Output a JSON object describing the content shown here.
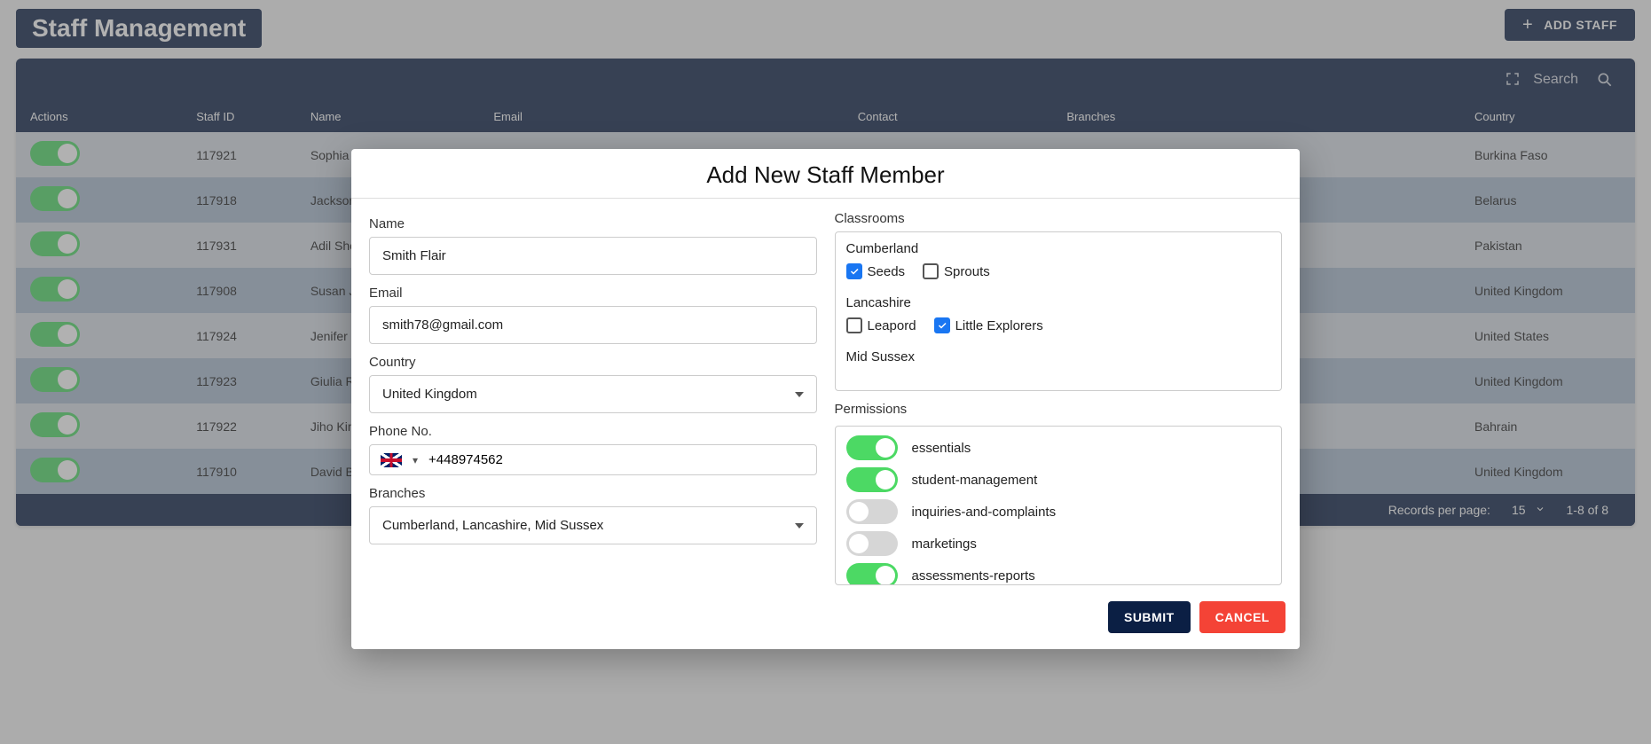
{
  "header": {
    "title": "Staff Management",
    "add_button_label": "ADD STAFF"
  },
  "search": {
    "label": "Search"
  },
  "table": {
    "columns": {
      "actions": "Actions",
      "staff_id": "Staff ID",
      "name": "Name",
      "email": "Email",
      "contact": "Contact",
      "branches": "Branches",
      "country": "Country"
    },
    "rows": [
      {
        "active": true,
        "staff_id": "117921",
        "name": "Sophia K",
        "country": "Burkina Faso"
      },
      {
        "active": true,
        "staff_id": "117918",
        "name": "Jackson",
        "country": "Belarus"
      },
      {
        "active": true,
        "staff_id": "117931",
        "name": "Adil She",
        "country": "Pakistan"
      },
      {
        "active": true,
        "staff_id": "117908",
        "name": "Susan J",
        "country": "United Kingdom"
      },
      {
        "active": true,
        "staff_id": "117924",
        "name": "Jenifer",
        "country": "United States"
      },
      {
        "active": true,
        "staff_id": "117923",
        "name": "Giulia Ro",
        "country": "United Kingdom"
      },
      {
        "active": true,
        "staff_id": "117922",
        "name": "Jiho Kim",
        "country": "Bahrain"
      },
      {
        "active": true,
        "staff_id": "117910",
        "name": "David Br",
        "country": "United Kingdom"
      }
    ]
  },
  "footer": {
    "records_label": "Records per page:",
    "records_value": "15",
    "range_text": "1-8 of 8"
  },
  "modal": {
    "title": "Add New Staff Member",
    "labels": {
      "name": "Name",
      "email": "Email",
      "country": "Country",
      "phone": "Phone No.",
      "branches": "Branches",
      "classrooms": "Classrooms",
      "permissions": "Permissions"
    },
    "fields": {
      "name_value": "Smith Flair",
      "email_value": "smith78@gmail.com",
      "country_value": "United Kingdom",
      "phone_value": "+448974562",
      "branches_value": "Cumberland, Lancashire, Mid Sussex"
    },
    "classrooms": [
      {
        "branch": "Cumberland",
        "rooms": [
          {
            "name": "Seeds",
            "checked": true
          },
          {
            "name": "Sprouts",
            "checked": false
          }
        ]
      },
      {
        "branch": "Lancashire",
        "rooms": [
          {
            "name": "Leapord",
            "checked": false
          },
          {
            "name": "Little Explorers",
            "checked": true
          }
        ]
      },
      {
        "branch": "Mid Sussex",
        "rooms": []
      }
    ],
    "permissions": [
      {
        "label": "essentials",
        "on": true
      },
      {
        "label": "student-management",
        "on": true
      },
      {
        "label": "inquiries-and-complaints",
        "on": false
      },
      {
        "label": "marketings",
        "on": false
      },
      {
        "label": "assessments-reports",
        "on": true
      }
    ],
    "buttons": {
      "submit": "SUBMIT",
      "cancel": "CANCEL"
    }
  }
}
